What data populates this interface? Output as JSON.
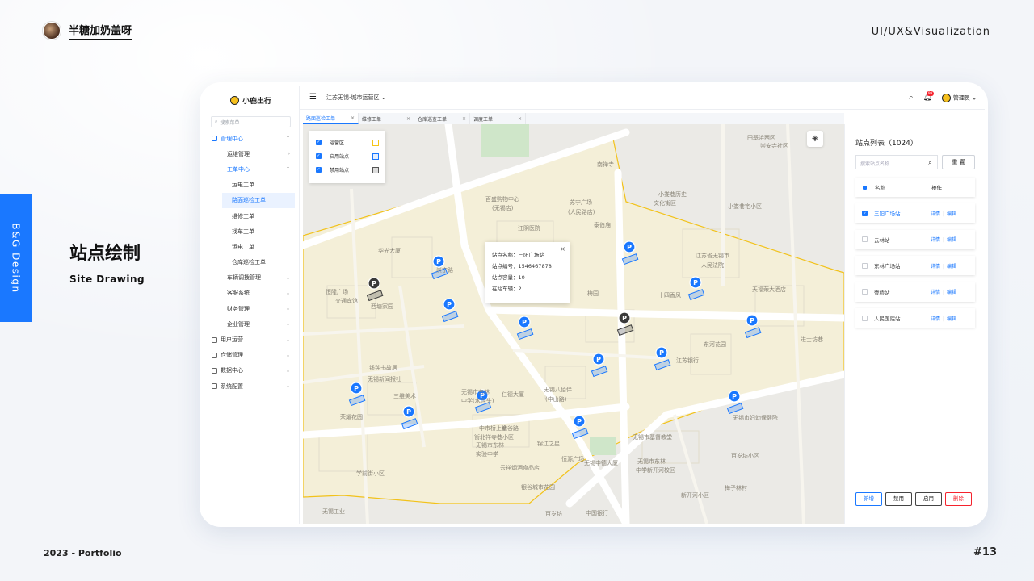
{
  "brand": {
    "name": "半糖加奶盖呀"
  },
  "header_right": "UI/UX&Visualization",
  "side_tab": "B&G Design",
  "slide": {
    "title": "站点绘制",
    "subtitle": "Site Drawing"
  },
  "footer": {
    "left": "2023 - Portfolio",
    "right": "#13"
  },
  "app": {
    "logo": "小鹿出行",
    "search_placeholder": "搜索菜单",
    "menu": [
      {
        "label": "管理中心",
        "level": 1,
        "state": "open"
      },
      {
        "label": "运维管理",
        "level": 2,
        "chevron": "›"
      },
      {
        "label": "工单中心",
        "level": 2,
        "state": "open"
      },
      {
        "label": "运电工单",
        "level": 3
      },
      {
        "label": "路面巡检工单",
        "level": 3,
        "state": "selected"
      },
      {
        "label": "维修工单",
        "level": 3
      },
      {
        "label": "找车工单",
        "level": 3
      },
      {
        "label": "运电工单",
        "level": 3
      },
      {
        "label": "仓库巡检工单",
        "level": 3
      },
      {
        "label": "车辆调拨管理",
        "level": 2,
        "chevron": "⌄"
      },
      {
        "label": "客服系统",
        "level": 2,
        "chevron": "⌄"
      },
      {
        "label": "财务管理",
        "level": 2,
        "chevron": "⌄"
      },
      {
        "label": "企业管理",
        "level": 2,
        "chevron": "⌄"
      },
      {
        "label": "用户运营",
        "level": 1,
        "chevron": "⌄"
      },
      {
        "label": "仓储管理",
        "level": 1,
        "chevron": "⌄"
      },
      {
        "label": "数据中心",
        "level": 1,
        "chevron": "⌄"
      },
      {
        "label": "系统配置",
        "level": 1,
        "chevron": "⌄"
      }
    ],
    "region": "江苏无锡-城市运营区",
    "admin": "管理员",
    "notification_count": "99",
    "tabs": [
      "路面巡检工单",
      "维修工单",
      "仓库巡查工单",
      "调度工单"
    ],
    "legend": [
      {
        "label": "运营区",
        "color": "#f5c518"
      },
      {
        "label": "启用站点",
        "color": "#1a78ff"
      },
      {
        "label": "禁用站点",
        "color": "#555555"
      }
    ],
    "popup": {
      "name": "站点名称：三阳广场站",
      "code": "站点编号：1546467878",
      "capacity": "站点容量：10",
      "vehicles": "在站车辆：2"
    },
    "panel": {
      "title": "站点列表（1024）",
      "search_placeholder": "搜索站点名称",
      "reset": "重 置",
      "col_name": "名称",
      "col_op": "操作",
      "op_detail": "详情",
      "op_edit": "编辑",
      "rows": [
        {
          "name": "三阳广场站",
          "checked": true
        },
        {
          "name": "云林站",
          "checked": false
        },
        {
          "name": "东林广场站",
          "checked": false
        },
        {
          "name": "壹桥站",
          "checked": false
        },
        {
          "name": "人民医院站",
          "checked": false
        }
      ],
      "buttons": [
        "新增",
        "禁用",
        "启用",
        "删除"
      ]
    },
    "map_labels": [
      "百盛购物中心",
      "(无锡店)",
      "苏宁广场",
      "(人民路店)",
      "江阴医院",
      "江苏省无锡市",
      "人民法院",
      "华光大厦",
      "崇宁路",
      "梅园",
      "十四香凤",
      "天福荣大酒店",
      "东河花园",
      "进士坊巷",
      "无锡市东林",
      "中学(水沟头)",
      "无锡八佰伴",
      "(中山路)",
      "江苏银行",
      "无锡市妇幼保健院",
      "荣耀花园",
      "中市桥上塘",
      "街北祥寺巷小区",
      "无锡市东林",
      "实验中学",
      "学前街小区",
      "云祥烟酒食品店",
      "无锡中德大厦",
      "无锡市基督教堂",
      "无锡市东林",
      "中学新开河校区",
      "新开河小区",
      "无锡工业",
      "恒源广场",
      "银谷城市花园",
      "中国银行",
      "钱钟书故居",
      "无锡新闻报社",
      "三维美术",
      "仁德大厦",
      "田基浜西区",
      "崇安寺社区",
      "泰伯庙",
      "小娄巷历史",
      "文化街区",
      "小娄巷宅小区",
      "西塘家园",
      "恒隆广场",
      "交通宾馆",
      "锦江之星",
      "金谷路",
      "百岁坊小区",
      "梅子林村",
      "南禅寺",
      "百岁坊"
    ]
  }
}
